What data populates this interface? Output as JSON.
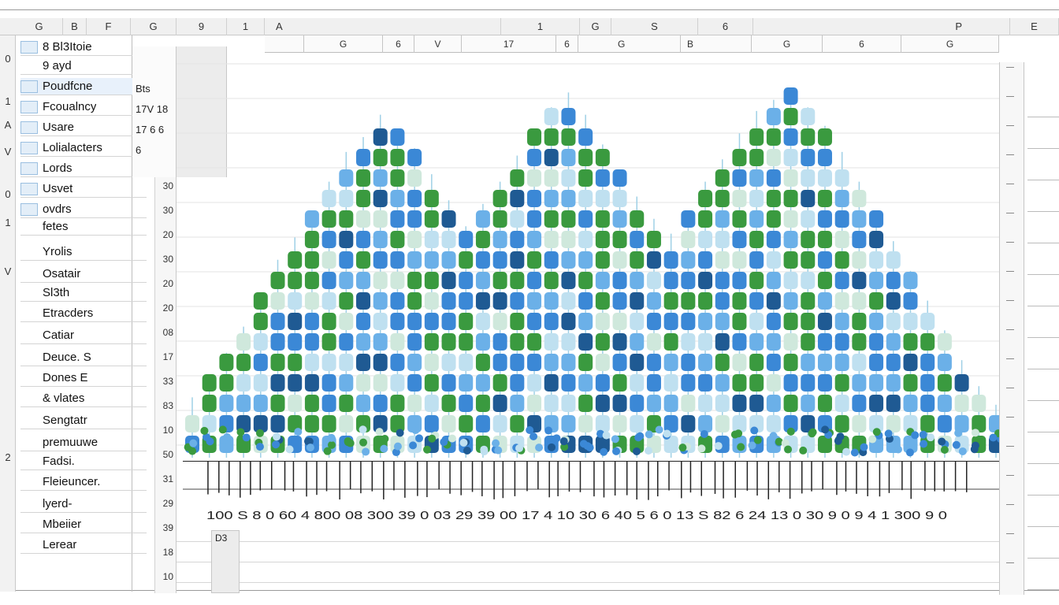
{
  "column_headers": [
    "G",
    "B",
    "F",
    "G",
    "9",
    "1",
    "A",
    "1",
    "G",
    "S",
    "6",
    "P",
    "E"
  ],
  "sub_headers": [
    "G",
    "6",
    "V",
    "17",
    "6",
    "G",
    "B",
    "G",
    "6",
    "G"
  ],
  "row_numbers": [
    "0",
    "1",
    "A",
    "V",
    "0",
    "1",
    "V",
    "2"
  ],
  "panel": {
    "items": [
      {
        "label": "8  Bl3Itoie",
        "ico": true
      },
      {
        "label": "9 ayd",
        "ico": false
      },
      {
        "label": "Poudfcne",
        "ico": true,
        "selected": true
      },
      {
        "label": "Fcoualncy",
        "ico": true
      },
      {
        "label": "Usare",
        "ico": true
      },
      {
        "label": "Lolialacters",
        "ico": true
      },
      {
        "label": "Lords",
        "ico": true
      },
      {
        "label": "Usvet",
        "ico": true
      },
      {
        "label": "ovdrs",
        "ico": true
      },
      {
        "label": "fetes",
        "ico": false
      },
      {
        "label": "Yrolis",
        "ico": false
      },
      {
        "label": "Osatair",
        "ico": false
      },
      {
        "label": "Sl3th",
        "ico": false
      },
      {
        "label": "Etracders",
        "ico": false
      },
      {
        "label": "Catiar",
        "ico": false
      },
      {
        "label": "Deuce. S",
        "ico": false
      },
      {
        "label": "Dones E",
        "ico": false
      },
      {
        "label": "& vlates",
        "ico": false
      },
      {
        "label": "Sengtatr",
        "ico": false
      },
      {
        "label": "premuuwe",
        "ico": false
      },
      {
        "label": "Fadsi.",
        "ico": false
      },
      {
        "label": "Fleieuncer.",
        "ico": false
      },
      {
        "label": "lyerd-",
        "ico": false
      },
      {
        "label": "Mbeiier",
        "ico": false
      },
      {
        "label": "Lerear",
        "ico": false
      }
    ]
  },
  "mini_values": [
    "Bts",
    "17V 18",
    "17 6 6",
    "6"
  ],
  "y_ticks": [
    "30",
    "30",
    "20",
    "30",
    "20",
    "20",
    "08",
    "17",
    "33",
    "83",
    "10",
    "50",
    "31",
    "29",
    "39",
    "18",
    "10"
  ],
  "x_ticks_text": "100 S 8 0 60 4 800 08 300 39 0 03 29 39 00 17 4 10 30 6 40 5 6 0 13 S 82 6 24 13 0 30 9 0 9 4 1 300 9 0",
  "d3_label": "D3",
  "colors": {
    "dark_blue": "#1f5a93",
    "mid_blue": "#3b88d6",
    "light_blue": "#6bb0e8",
    "green": "#3a9a3f",
    "pale": "#cfe8dc",
    "pale_blue": "#bfe0f0"
  },
  "chart_data": {
    "type": "scatter",
    "series": [
      {
        "name": "",
        "values": [
          12,
          18,
          24,
          31,
          40,
          49,
          55,
          62,
          70,
          78,
          82,
          88,
          84,
          79,
          72,
          65,
          58,
          64,
          70,
          77,
          84,
          90,
          94,
          88,
          80,
          73,
          66,
          60,
          56,
          62,
          70,
          76,
          83,
          89,
          92,
          95,
          90,
          85,
          78,
          70,
          62,
          54,
          46,
          38,
          30,
          22,
          15,
          10
        ]
      }
    ],
    "xlabel": "",
    "ylabel": ""
  }
}
